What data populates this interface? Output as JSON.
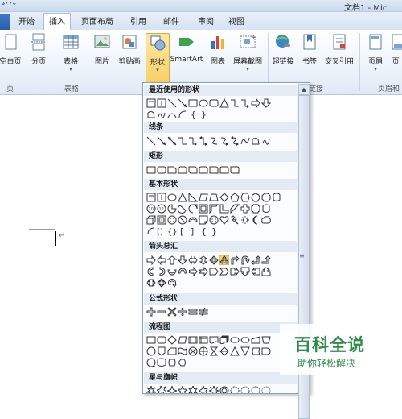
{
  "window": {
    "title": "文档1 - Mic",
    "qat_icons": [
      "undo-icon",
      "redo-icon"
    ]
  },
  "tabs": [
    {
      "label": "开始"
    },
    {
      "label": "插入",
      "active": true
    },
    {
      "label": "页面布局"
    },
    {
      "label": "引用"
    },
    {
      "label": "邮件"
    },
    {
      "label": "审阅"
    },
    {
      "label": "视图"
    }
  ],
  "ribbon": {
    "buttons": [
      {
        "label": "空白页",
        "icon": "blank-page-icon"
      },
      {
        "label": "分页",
        "icon": "page-break-icon"
      },
      {
        "label": "表格",
        "icon": "table-icon"
      },
      {
        "label": "图片",
        "icon": "picture-icon"
      },
      {
        "label": "剪贴画",
        "icon": "clipart-icon"
      },
      {
        "label": "形状",
        "icon": "shapes-icon"
      },
      {
        "label": "SmartArt",
        "icon": "smartart-icon"
      },
      {
        "label": "图表",
        "icon": "chart-icon"
      },
      {
        "label": "屏幕截图",
        "icon": "screenshot-icon"
      },
      {
        "label": "超链接",
        "icon": "hyperlink-icon"
      },
      {
        "label": "书签",
        "icon": "bookmark-icon"
      },
      {
        "label": "交叉引用",
        "icon": "cross-reference-icon"
      },
      {
        "label": "页眉",
        "icon": "header-icon"
      },
      {
        "label": "页",
        "icon": "footer-icon"
      }
    ],
    "groups": [
      {
        "label": "页"
      },
      {
        "label": "表格"
      },
      {
        "label": "链接"
      },
      {
        "label": "页眉和"
      }
    ]
  },
  "document": {
    "paragraph_mark": "↵"
  },
  "shapes_menu": {
    "sections": [
      {
        "title": "最近使用的形状"
      },
      {
        "title": "线条"
      },
      {
        "title": "矩形"
      },
      {
        "title": "基本形状"
      },
      {
        "title": "箭头总汇"
      },
      {
        "title": "公式形状"
      },
      {
        "title": "流程图"
      },
      {
        "title": "星与旗帜"
      }
    ],
    "highlight_color": "#fbd86a"
  },
  "watermark": {
    "title": "百科全说",
    "subtitle": "助你轻松解决"
  }
}
